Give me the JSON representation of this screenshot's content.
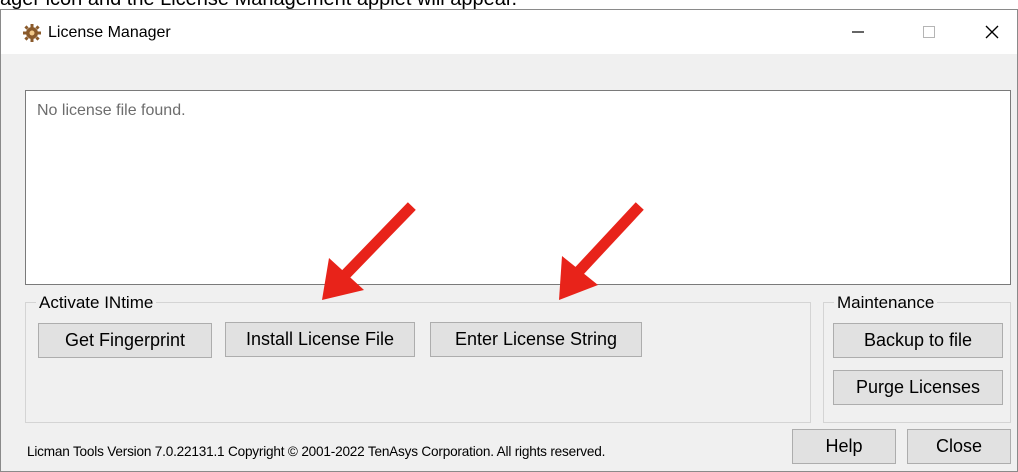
{
  "document": {
    "caption_text": "ager icon and the License Management applet will appear."
  },
  "window": {
    "title": "License Manager",
    "icons": [
      "gear-icon",
      "minimize-icon",
      "maximize-icon",
      "close-icon"
    ]
  },
  "license_info": {
    "text": "No license file found."
  },
  "activate_group": {
    "label": "Activate INtime",
    "buttons": {
      "get_fingerprint": "Get Fingerprint",
      "install_license_file": "Install License File",
      "enter_license_string": "Enter License String"
    }
  },
  "maintenance_group": {
    "label": "Maintenance",
    "buttons": {
      "backup_to_file": "Backup to file",
      "purge_licenses": "Purge Licenses"
    }
  },
  "footer": {
    "version_text": "Licman Tools Version 7.0.22131.1 Copyright © 2001-2022 TenAsys Corporation. All rights reserved.",
    "help": "Help",
    "close": "Close"
  },
  "annotations": {
    "arrow_color": "#e8231a"
  }
}
